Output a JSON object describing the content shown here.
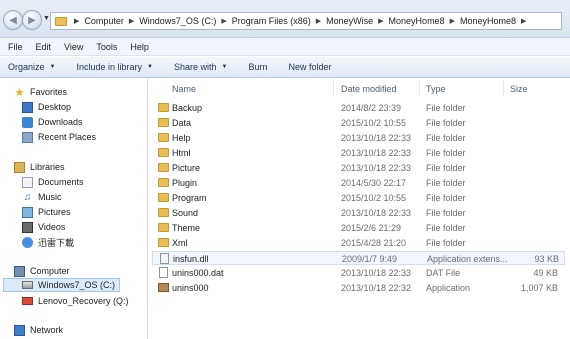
{
  "address": {
    "crumbs": [
      "Computer",
      "Windows7_OS (C:)",
      "Program Files (x86)",
      "MoneyWise",
      "MoneyHome8",
      "MoneyHome8"
    ]
  },
  "menu": [
    "File",
    "Edit",
    "View",
    "Tools",
    "Help"
  ],
  "commands": [
    {
      "label": "Organize",
      "dropdown": true
    },
    {
      "label": "Include in library",
      "dropdown": true
    },
    {
      "label": "Share with",
      "dropdown": true
    },
    {
      "label": "Burn",
      "dropdown": false
    },
    {
      "label": "New folder",
      "dropdown": false
    }
  ],
  "nav": {
    "favorites": {
      "label": "Favorites",
      "items": [
        "Desktop",
        "Downloads",
        "Recent Places"
      ]
    },
    "libraries": {
      "label": "Libraries",
      "items": [
        "Documents",
        "Music",
        "Pictures",
        "Videos",
        "迅雷下載"
      ]
    },
    "computer": {
      "label": "Computer",
      "items": [
        "Windows7_OS (C:)",
        "Lenovo_Recovery (Q:)"
      ]
    },
    "network": {
      "label": "Network"
    }
  },
  "columns": {
    "name": "Name",
    "date": "Date modified",
    "type": "Type",
    "size": "Size"
  },
  "files": [
    {
      "name": "Backup",
      "date": "2014/8/2 23:39",
      "type": "File folder",
      "size": "",
      "icon": "folder-icon"
    },
    {
      "name": "Data",
      "date": "2015/10/2 10:55",
      "type": "File folder",
      "size": "",
      "icon": "folder-icon"
    },
    {
      "name": "Help",
      "date": "2013/10/18 22:33",
      "type": "File folder",
      "size": "",
      "icon": "folder-icon"
    },
    {
      "name": "Html",
      "date": "2013/10/18 22:33",
      "type": "File folder",
      "size": "",
      "icon": "folder-icon"
    },
    {
      "name": "Picture",
      "date": "2013/10/18 22:33",
      "type": "File folder",
      "size": "",
      "icon": "folder-icon"
    },
    {
      "name": "Plugin",
      "date": "2014/5/30 22:17",
      "type": "File folder",
      "size": "",
      "icon": "folder-icon"
    },
    {
      "name": "Program",
      "date": "2015/10/2 10:55",
      "type": "File folder",
      "size": "",
      "icon": "folder-icon"
    },
    {
      "name": "Sound",
      "date": "2013/10/18 22:33",
      "type": "File folder",
      "size": "",
      "icon": "folder-icon"
    },
    {
      "name": "Theme",
      "date": "2015/2/6 21:29",
      "type": "File folder",
      "size": "",
      "icon": "folder-icon"
    },
    {
      "name": "Xml",
      "date": "2015/4/28 21:20",
      "type": "File folder",
      "size": "",
      "icon": "folder-icon"
    },
    {
      "name": "insfun.dll",
      "date": "2009/1/7 9:49",
      "type": "Application extens...",
      "size": "93 KB",
      "icon": "dll-file-icon"
    },
    {
      "name": "unins000.dat",
      "date": "2013/10/18 22:33",
      "type": "DAT File",
      "size": "49 KB",
      "icon": "dat-file-icon"
    },
    {
      "name": "unins000",
      "date": "2013/10/18 22:32",
      "type": "Application",
      "size": "1,007 KB",
      "icon": "application-icon"
    }
  ],
  "selected_file_index": 10
}
